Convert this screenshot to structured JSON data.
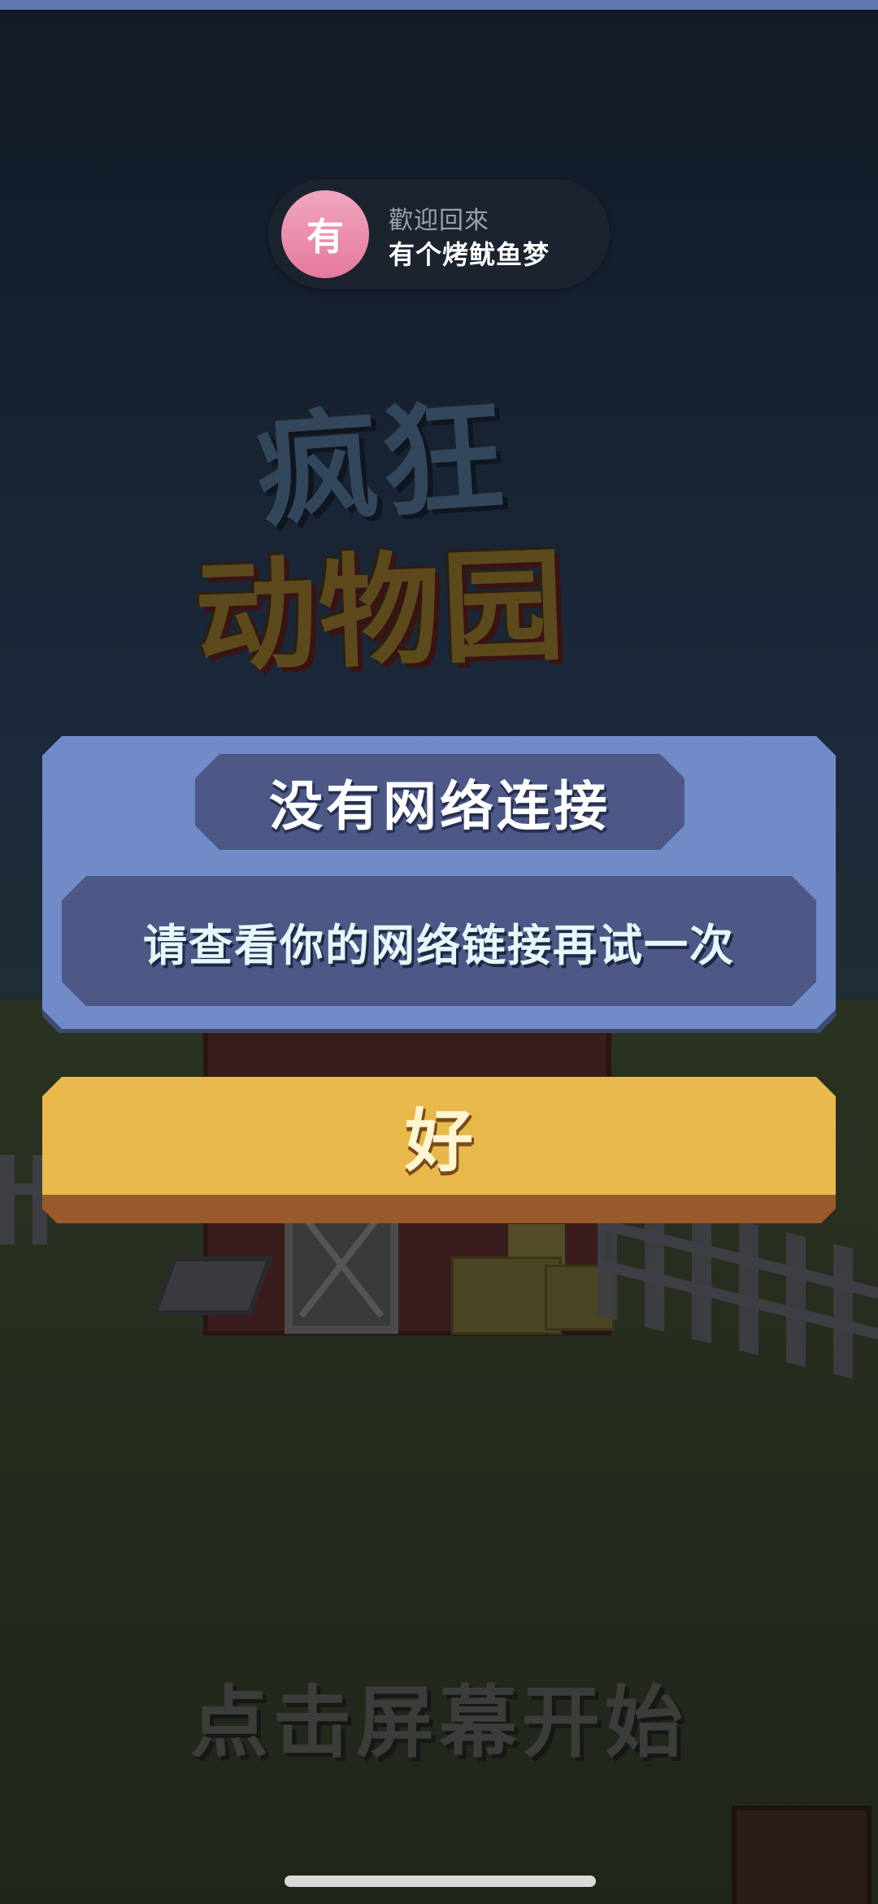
{
  "welcome": {
    "avatar_text": "有",
    "label": "歡迎回來",
    "username": "有个烤鱿鱼梦"
  },
  "logo": {
    "line1": "疯狂",
    "line2": "动物园"
  },
  "dialog": {
    "title": "没有网络连接",
    "message": "请查看你的网络链接再试一次",
    "ok_label": "好"
  },
  "tap_to_start": "点击屏幕开始",
  "colors": {
    "dialog_bg": "#718bc9",
    "dialog_inner": "#4d5886",
    "ok_button": "#e8b94a",
    "avatar": "#e67a9c"
  }
}
